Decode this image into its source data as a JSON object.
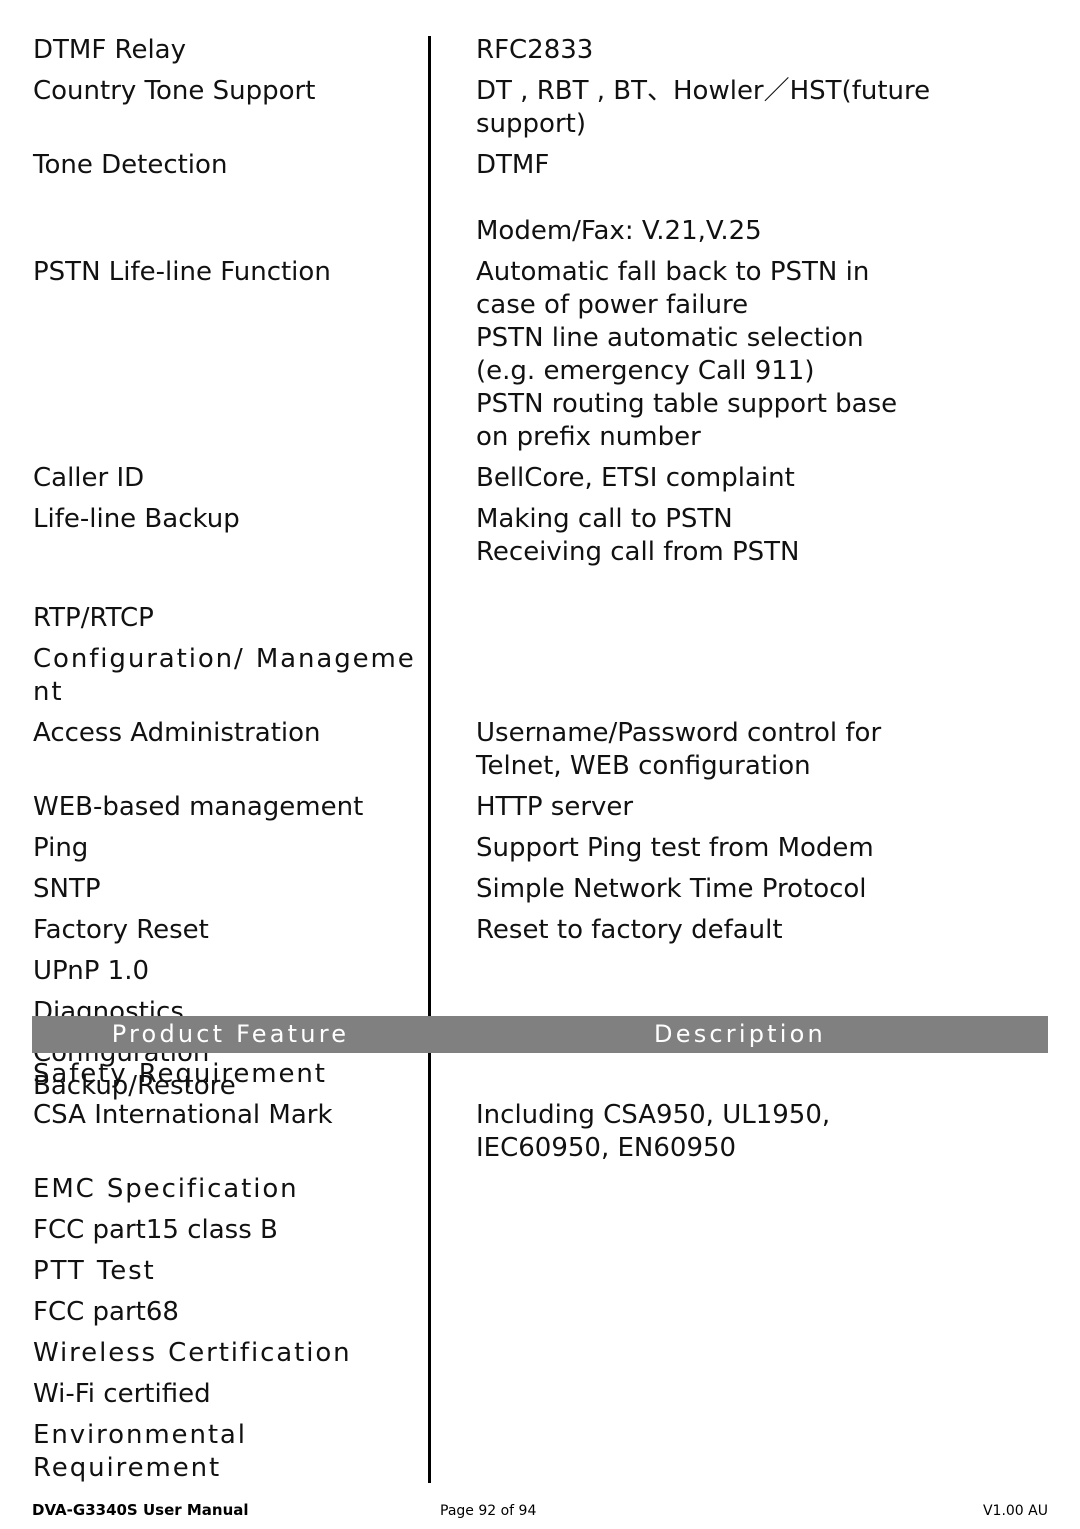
{
  "document": {
    "title": "DVA-G3340S User Manual",
    "page_label": "Page 92 of 94",
    "version": "V1.00 AU"
  },
  "table_top": {
    "rows": [
      {
        "feature": [
          "DTMF Relay"
        ],
        "feature_spaced": false,
        "description": [
          "RFC2833"
        ],
        "gap_after": 0
      },
      {
        "feature": [
          "Country Tone Support"
        ],
        "feature_spaced": false,
        "description": [
          "DT , RBT , BT、Howler／HST(future",
          "support)"
        ],
        "gap_after": 0
      },
      {
        "feature": [
          "Tone Detection"
        ],
        "feature_spaced": false,
        "description": [
          "DTMF",
          "",
          "Modem/Fax: V.21,V.25"
        ],
        "gap_after": 0
      },
      {
        "feature": [
          "PSTN Life-line Function"
        ],
        "feature_spaced": false,
        "description": [
          "Automatic fall back to PSTN in",
          "case of power failure",
          "PSTN line automatic selection",
          "(e.g. emergency Call 911)",
          "PSTN routing table support base",
          "on prefix number"
        ],
        "gap_after": 0
      },
      {
        "feature": [
          "Caller ID"
        ],
        "feature_spaced": false,
        "description": [
          "BellCore, ETSI complaint"
        ],
        "gap_after": 0
      },
      {
        "feature": [
          "Life-line Backup"
        ],
        "feature_spaced": false,
        "description": [
          "Making call to PSTN",
          "Receiving call from PSTN"
        ],
        "gap_after": 1
      },
      {
        "feature": [
          "RTP/RTCP"
        ],
        "feature_spaced": false,
        "description": [],
        "gap_after": 0
      },
      {
        "feature": [
          "Configuration/ Manageme",
          "nt"
        ],
        "feature_spaced": true,
        "description": [],
        "gap_after": 0
      },
      {
        "feature": [
          "Access Administration"
        ],
        "feature_spaced": false,
        "description": [
          "Username/Password control for",
          "Telnet, WEB configuration"
        ],
        "gap_after": 0
      },
      {
        "feature": [
          "WEB-based management"
        ],
        "feature_spaced": false,
        "description": [
          "HTTP server"
        ],
        "gap_after": 0
      },
      {
        "feature": [
          "Ping"
        ],
        "feature_spaced": false,
        "description": [
          "Support Ping test from Modem"
        ],
        "gap_after": 0
      },
      {
        "feature": [
          "SNTP"
        ],
        "feature_spaced": false,
        "description": [
          "Simple Network Time Protocol"
        ],
        "gap_after": 0
      },
      {
        "feature": [
          "Factory Reset"
        ],
        "feature_spaced": false,
        "description": [
          "Reset to factory default"
        ],
        "gap_after": 0
      },
      {
        "feature": [
          "UPnP 1.0"
        ],
        "feature_spaced": false,
        "description": [],
        "gap_after": 0
      },
      {
        "feature": [
          "Diagnostics"
        ],
        "feature_spaced": false,
        "description": [],
        "gap_after": 0
      },
      {
        "feature": [
          "Configuration",
          "Backup/Restore"
        ],
        "feature_spaced": false,
        "description": [],
        "gap_after": 0
      }
    ]
  },
  "header_row": {
    "feature_label": "Product Feature",
    "description_label": "Description",
    "background_color": "#808080",
    "text_color": "#ffffff"
  },
  "table_bottom": {
    "rows": [
      {
        "feature": [
          "Safety Requirement"
        ],
        "feature_spaced": true,
        "description": [],
        "gap_after": 0
      },
      {
        "feature": [
          "CSA International Mark"
        ],
        "feature_spaced": false,
        "description": [
          "Including CSA950, UL1950,",
          "IEC60950, EN60950"
        ],
        "gap_after": 0
      },
      {
        "feature": [
          "EMC Specification"
        ],
        "feature_spaced": true,
        "description": [],
        "gap_after": 0
      },
      {
        "feature": [
          "FCC part15 class B"
        ],
        "feature_spaced": false,
        "description": [],
        "gap_after": 0
      },
      {
        "feature": [
          "PTT Test"
        ],
        "feature_spaced": true,
        "description": [],
        "gap_after": 0
      },
      {
        "feature": [
          "FCC part68"
        ],
        "feature_spaced": false,
        "description": [],
        "gap_after": 0
      },
      {
        "feature": [
          "Wireless Certification"
        ],
        "feature_spaced": true,
        "description": [],
        "gap_after": 0
      },
      {
        "feature": [
          "Wi-Fi certified"
        ],
        "feature_spaced": false,
        "description": [],
        "gap_after": 0
      },
      {
        "feature": [
          "Environmental",
          "Requirement"
        ],
        "feature_spaced": true,
        "description": [],
        "gap_after": 0
      }
    ]
  }
}
